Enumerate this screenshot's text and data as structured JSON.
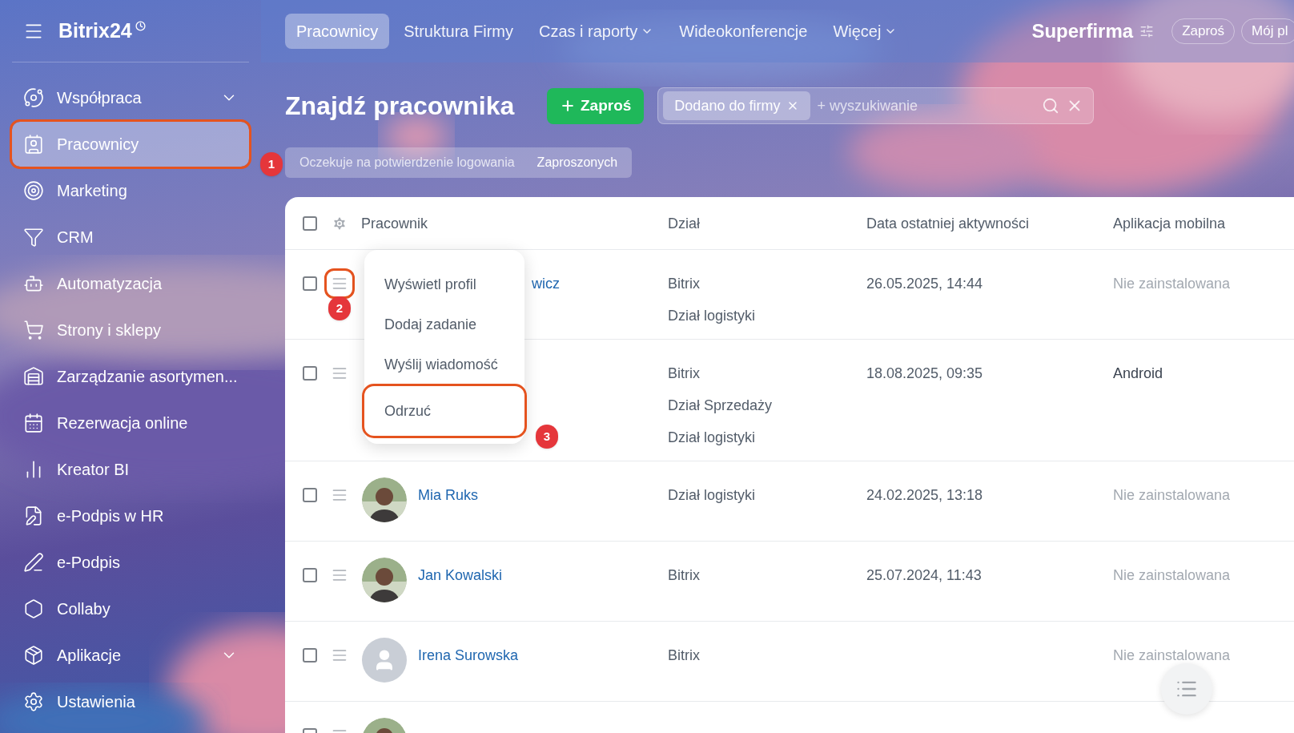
{
  "sidebar": {
    "title": "Bitrix24",
    "items": [
      {
        "label": "Współpraca",
        "selected": false,
        "expandable": true
      },
      {
        "label": "Pracownicy",
        "selected": true,
        "expandable": false,
        "callout": "1"
      },
      {
        "label": "Marketing",
        "selected": false,
        "expandable": false
      },
      {
        "label": "CRM",
        "selected": false,
        "expandable": false
      },
      {
        "label": "Automatyzacja",
        "selected": false,
        "expandable": false
      },
      {
        "label": "Strony i sklepy",
        "selected": false,
        "expandable": false
      },
      {
        "label": "Zarządzanie asortymen...",
        "selected": false,
        "expandable": false
      },
      {
        "label": "Rezerwacja online",
        "selected": false,
        "expandable": false
      },
      {
        "label": "Kreator BI",
        "selected": false,
        "expandable": false
      },
      {
        "label": "e-Podpis w HR",
        "selected": false,
        "expandable": false
      },
      {
        "label": "e-Podpis",
        "selected": false,
        "expandable": false
      },
      {
        "label": "Collaby",
        "selected": false,
        "expandable": false
      },
      {
        "label": "Aplikacje",
        "selected": false,
        "expandable": true
      },
      {
        "label": "Ustawienia",
        "selected": false,
        "expandable": false
      }
    ]
  },
  "topnav": {
    "tabs": [
      {
        "label": "Pracownicy",
        "selected": true,
        "dropdown": false
      },
      {
        "label": "Struktura Firmy",
        "selected": false,
        "dropdown": false
      },
      {
        "label": "Czas i raporty",
        "selected": false,
        "dropdown": true
      },
      {
        "label": "Wideokonferencje",
        "selected": false,
        "dropdown": false
      },
      {
        "label": "Więcej",
        "selected": false,
        "dropdown": true
      }
    ],
    "company": "Superfirma",
    "buttons": [
      "Zaproś",
      "Mój pl"
    ]
  },
  "page": {
    "title": "Znajdź pracownika",
    "invite_button": "Zaproś",
    "filter": {
      "tag": "Dodano do firmy",
      "placeholder": "+ wyszukiwanie"
    },
    "subtabs": [
      {
        "label": "Oczekuje na potwierdzenie logowania",
        "selected": false
      },
      {
        "label": "Zaproszonych",
        "selected": true
      }
    ]
  },
  "table": {
    "columns": [
      "Pracownik",
      "Dział",
      "Data ostatniej aktywności",
      "Aplikacja mobilna"
    ],
    "rows": [
      {
        "kind": "covered",
        "checked": false,
        "name": "wicz",
        "departments": [
          "Bitrix",
          "Dział logistyki"
        ],
        "last_active": "26.05.2025, 14:44",
        "mobile_app": "Nie zainstalowana",
        "app_installed": false,
        "callout": "2"
      },
      {
        "kind": "hidden",
        "checked": false,
        "departments": [
          "Bitrix",
          "Dział Sprzedaży",
          "Dział logistyki"
        ],
        "last_active": "18.08.2025, 09:35",
        "mobile_app": "Android",
        "app_installed": true
      },
      {
        "checked": false,
        "name": "Mia Ruks",
        "departments": [
          "Dział logistyki"
        ],
        "last_active": "24.02.2025, 13:18",
        "mobile_app": "Nie zainstalowana",
        "app_installed": false
      },
      {
        "checked": false,
        "name": "Jan Kowalski",
        "departments": [
          "Bitrix"
        ],
        "last_active": "25.07.2024, 11:43",
        "mobile_app": "Nie zainstalowana",
        "app_installed": false
      },
      {
        "kind": "placeholder",
        "checked": false,
        "name": "Irena Surowska",
        "departments": [
          "Bitrix"
        ],
        "mobile_app": "Nie zainstalowana",
        "app_installed": false
      },
      {
        "checked": false,
        "departments": []
      }
    ],
    "all_checked": false
  },
  "context_menu": {
    "items": [
      {
        "label": "Wyświetl profil"
      },
      {
        "label": "Dodaj zadanie"
      },
      {
        "label": "Wyślij wiadomość"
      },
      {
        "label": "Odrzuć",
        "callout": "3"
      }
    ]
  }
}
